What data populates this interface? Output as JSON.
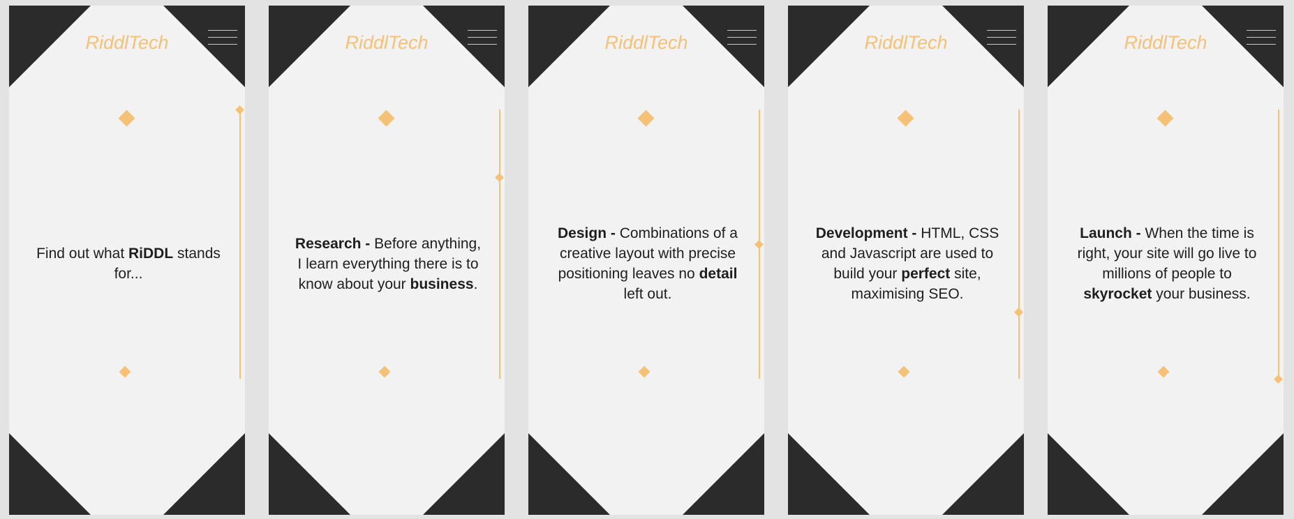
{
  "brand": {
    "logo_text": "RiddlTech"
  },
  "colors": {
    "accent": "#f5c177",
    "dark": "#2b2b2b",
    "screen_bg": "#f2f2f2",
    "page_bg": "#e3e3e3",
    "text": "#1e1e1e"
  },
  "icons": {
    "menu": "hamburger-menu-icon",
    "diamond": "diamond-icon"
  },
  "screens": [
    {
      "progress": 0.0,
      "text": [
        {
          "t": "Find out what "
        },
        {
          "t": "RiDDL",
          "b": true
        },
        {
          "t": " stands for..."
        }
      ]
    },
    {
      "progress": 0.25,
      "text": [
        {
          "t": "Research -",
          "b": true
        },
        {
          "t": " Before anything, I learn everything there is to know about your "
        },
        {
          "t": "business",
          "b": true
        },
        {
          "t": "."
        }
      ]
    },
    {
      "progress": 0.5,
      "text": [
        {
          "t": "Design -",
          "b": true
        },
        {
          "t": " Combinations of a creative layout with precise positioning leaves no "
        },
        {
          "t": "detail",
          "b": true
        },
        {
          "t": " left out."
        }
      ]
    },
    {
      "progress": 0.75,
      "text": [
        {
          "t": "Development -",
          "b": true
        },
        {
          "t": " HTML, CSS and Javascript are used to build your "
        },
        {
          "t": "perfect",
          "b": true
        },
        {
          "t": " site, maximising SEO."
        }
      ]
    },
    {
      "progress": 1.0,
      "text": [
        {
          "t": "Launch -",
          "b": true
        },
        {
          "t": " When the time is right, your site will go live to millions of people to "
        },
        {
          "t": "skyrocket",
          "b": true
        },
        {
          "t": " your business."
        }
      ]
    }
  ]
}
